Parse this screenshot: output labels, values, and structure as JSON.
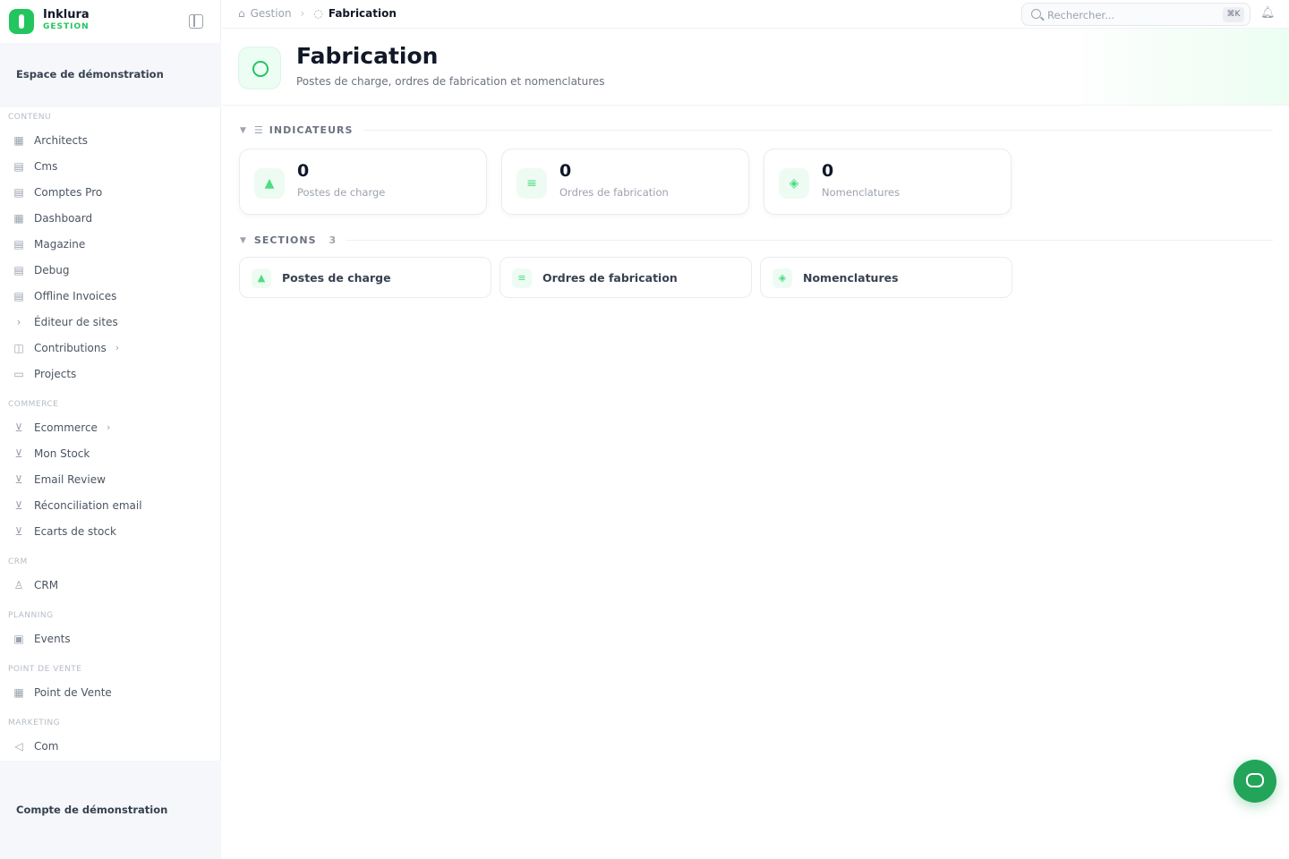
{
  "brand": {
    "name": "Inklura",
    "sub": "GESTION"
  },
  "workspace": "Espace de démonstration",
  "account": "Compte de démonstration",
  "sidebar": {
    "sections": [
      {
        "label": "CONTENU",
        "items": [
          {
            "label": "Architects",
            "icon": "building-icon",
            "glyph": "▦"
          },
          {
            "label": "Cms",
            "icon": "document-icon",
            "glyph": "▤"
          },
          {
            "label": "Comptes Pro",
            "icon": "document-icon",
            "glyph": "▤"
          },
          {
            "label": "Dashboard",
            "icon": "grid-icon",
            "glyph": "▦"
          },
          {
            "label": "Magazine",
            "icon": "newspaper-icon",
            "glyph": "▤"
          },
          {
            "label": "Debug",
            "icon": "document-icon",
            "glyph": "▤"
          },
          {
            "label": "Offline Invoices",
            "icon": "document-icon",
            "glyph": "▤"
          },
          {
            "label": "Éditeur de sites",
            "icon": "terminal-icon",
            "glyph": "›"
          },
          {
            "label": "Contributions",
            "icon": "inbox-icon",
            "glyph": "◫",
            "chevron": "›"
          },
          {
            "label": "Projects",
            "icon": "folder-icon",
            "glyph": "▭"
          }
        ]
      },
      {
        "label": "COMMERCE",
        "items": [
          {
            "label": "Ecommerce",
            "icon": "cart-icon",
            "glyph": "⊻",
            "chevron": "›"
          },
          {
            "label": "Mon Stock",
            "icon": "cart-icon",
            "glyph": "⊻"
          },
          {
            "label": "Email Review",
            "icon": "cart-icon",
            "glyph": "⊻"
          },
          {
            "label": "Réconciliation email",
            "icon": "cart-icon",
            "glyph": "⊻"
          },
          {
            "label": "Ecarts de stock",
            "icon": "cart-icon",
            "glyph": "⊻"
          }
        ]
      },
      {
        "label": "CRM",
        "items": [
          {
            "label": "CRM",
            "icon": "user-icon",
            "glyph": "♙"
          }
        ]
      },
      {
        "label": "PLANNING",
        "items": [
          {
            "label": "Events",
            "icon": "calendar-icon",
            "glyph": "▣"
          }
        ]
      },
      {
        "label": "POINT DE VENTE",
        "items": [
          {
            "label": "Point de Vente",
            "icon": "store-icon",
            "glyph": "▦"
          }
        ]
      },
      {
        "label": "MARKETING",
        "items": [
          {
            "label": "Com",
            "icon": "megaphone-icon",
            "glyph": "◁"
          }
        ]
      }
    ]
  },
  "topbar": {
    "breadcrumb": [
      "Gestion",
      "Fabrication"
    ],
    "search_placeholder": "Rechercher...",
    "search_shortcut": "⌘K"
  },
  "header": {
    "title": "Fabrication",
    "subtitle": "Postes de charge, ordres de fabrication et nomenclatures"
  },
  "indicators": {
    "label": "INDICATEURS",
    "cards": [
      {
        "value": "0",
        "label": "Postes de charge",
        "icon": "factory-icon",
        "glyph": "▲"
      },
      {
        "value": "0",
        "label": "Ordres de fabrication",
        "icon": "list-icon",
        "glyph": "≡"
      },
      {
        "value": "0",
        "label": "Nomenclatures",
        "icon": "package-icon",
        "glyph": "◈"
      }
    ]
  },
  "sections": {
    "label": "SECTIONS",
    "count": "3",
    "cards": [
      {
        "label": "Postes de charge",
        "icon": "factory-icon",
        "glyph": "▲"
      },
      {
        "label": "Ordres de fabrication",
        "icon": "list-icon",
        "glyph": "≡"
      },
      {
        "label": "Nomenclatures",
        "icon": "package-icon",
        "glyph": "◈"
      }
    ]
  },
  "colors": {
    "accent": "#22c55e",
    "chat": "#22a559"
  }
}
